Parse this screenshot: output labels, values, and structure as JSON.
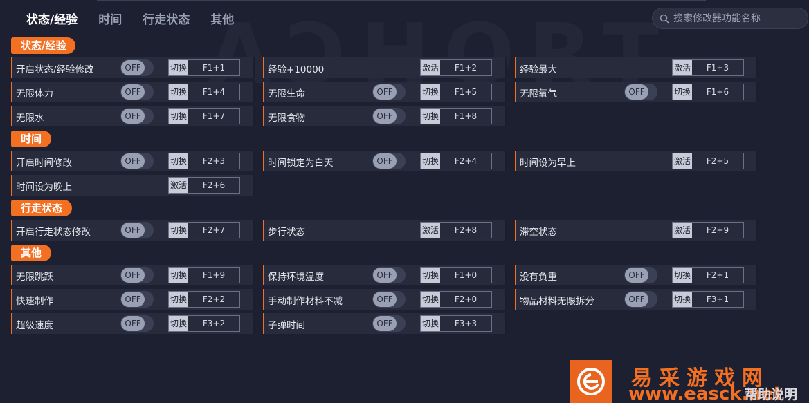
{
  "nav": {
    "tabs": [
      "状态/经验",
      "时间",
      "行走状态",
      "其他"
    ],
    "active_index": 0
  },
  "search": {
    "placeholder": "搜索修改器功能名称"
  },
  "colors": {
    "accent": "#f36f21",
    "background": "#1d2030",
    "row": "#272b3c"
  },
  "sections": [
    {
      "title": "状态/经验",
      "rows": [
        {
          "label": "开启状态/经验修改",
          "toggle": "OFF",
          "mode": "切换",
          "hotkey": "F1+1"
        },
        {
          "label": "经验+10000",
          "mode": "激活",
          "hotkey": "F1+2"
        },
        {
          "label": "经验最大",
          "mode": "激活",
          "hotkey": "F1+3"
        },
        {
          "label": "无限体力",
          "toggle": "OFF",
          "mode": "切换",
          "hotkey": "F1+4"
        },
        {
          "label": "无限生命",
          "toggle": "OFF",
          "mode": "切换",
          "hotkey": "F1+5"
        },
        {
          "label": "无限氧气",
          "toggle": "OFF",
          "mode": "切换",
          "hotkey": "F1+6"
        },
        {
          "label": "无限水",
          "toggle": "OFF",
          "mode": "切换",
          "hotkey": "F1+7"
        },
        {
          "label": "无限食物",
          "toggle": "OFF",
          "mode": "切换",
          "hotkey": "F1+8"
        }
      ]
    },
    {
      "title": "时间",
      "rows": [
        {
          "label": "开启时间修改",
          "toggle": "OFF",
          "mode": "切换",
          "hotkey": "F2+3"
        },
        {
          "label": "时间锁定为白天",
          "toggle": "OFF",
          "mode": "切换",
          "hotkey": "F2+4"
        },
        {
          "label": "时间设为早上",
          "mode": "激活",
          "hotkey": "F2+5"
        },
        {
          "label": "时间设为晚上",
          "mode": "激活",
          "hotkey": "F2+6"
        }
      ]
    },
    {
      "title": "行走状态",
      "rows": [
        {
          "label": "开启行走状态修改",
          "toggle": "OFF",
          "mode": "切换",
          "hotkey": "F2+7"
        },
        {
          "label": "步行状态",
          "mode": "激活",
          "hotkey": "F2+8"
        },
        {
          "label": "滞空状态",
          "mode": "激活",
          "hotkey": "F2+9"
        }
      ]
    },
    {
      "title": "其他",
      "rows": [
        {
          "label": "无限跳跃",
          "toggle": "OFF",
          "mode": "切换",
          "hotkey": "F1+9"
        },
        {
          "label": "保持环境温度",
          "toggle": "OFF",
          "mode": "切换",
          "hotkey": "F1+0"
        },
        {
          "label": "没有负重",
          "toggle": "OFF",
          "mode": "切换",
          "hotkey": "F2+1"
        },
        {
          "label": "快速制作",
          "toggle": "OFF",
          "mode": "切换",
          "hotkey": "F2+2"
        },
        {
          "label": "手动制作材料不减",
          "toggle": "OFF",
          "mode": "切换",
          "hotkey": "F2+0"
        },
        {
          "label": "物品材料无限拆分",
          "toggle": "OFF",
          "mode": "切换",
          "hotkey": "F3+1"
        },
        {
          "label": "超级速度",
          "toggle": "OFF",
          "mode": "切换",
          "hotkey": "F3+2"
        },
        {
          "label": "子弹时间",
          "toggle": "OFF",
          "mode": "切换",
          "hotkey": "F3+3"
        }
      ]
    }
  ],
  "watermark": {
    "site_name": "易采游戏网",
    "site_url": "www.easck.net",
    "help": "帮助说明"
  }
}
